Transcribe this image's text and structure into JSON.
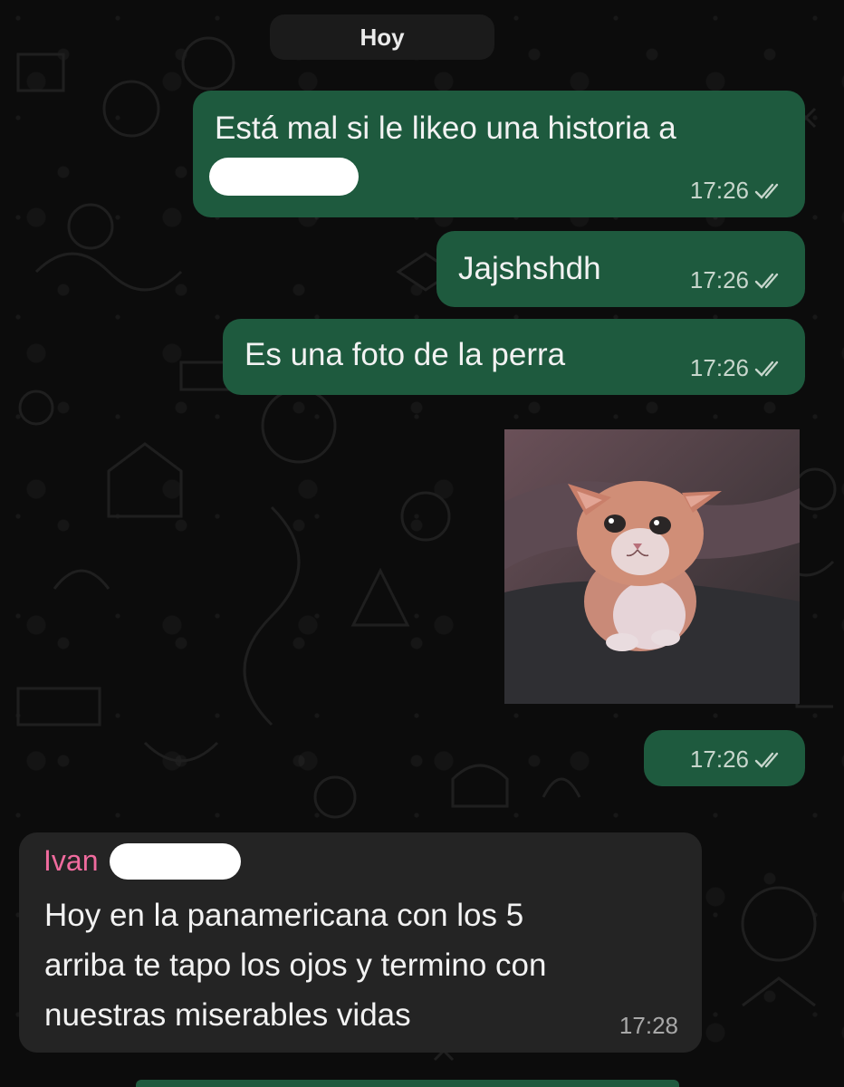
{
  "date_separator": "Hoy",
  "messages": [
    {
      "direction": "out",
      "text_line1": "Está mal si le likeo una historia a",
      "time": "17:26",
      "status": "read"
    },
    {
      "direction": "out",
      "text": "Jajshshdh",
      "time": "17:26",
      "status": "read"
    },
    {
      "direction": "out",
      "text": "Es una foto de la perra",
      "time": "17:26",
      "status": "read"
    },
    {
      "direction": "out",
      "type": "image",
      "time": "17:26",
      "status": "read"
    },
    {
      "direction": "in",
      "sender": "Ivan",
      "lines": [
        "Hoy en la panamericana con los 5",
        "arriba te tapo los ojos y termino con",
        "nuestras miserables vidas"
      ],
      "time": "17:28"
    }
  ],
  "icons": {
    "read_receipt": "double-check-icon"
  },
  "colors": {
    "outgoing_bubble": "#1e5a3e",
    "incoming_bubble": "#242424",
    "sender_name": "#f06b9e",
    "background": "#0c0c0c"
  }
}
